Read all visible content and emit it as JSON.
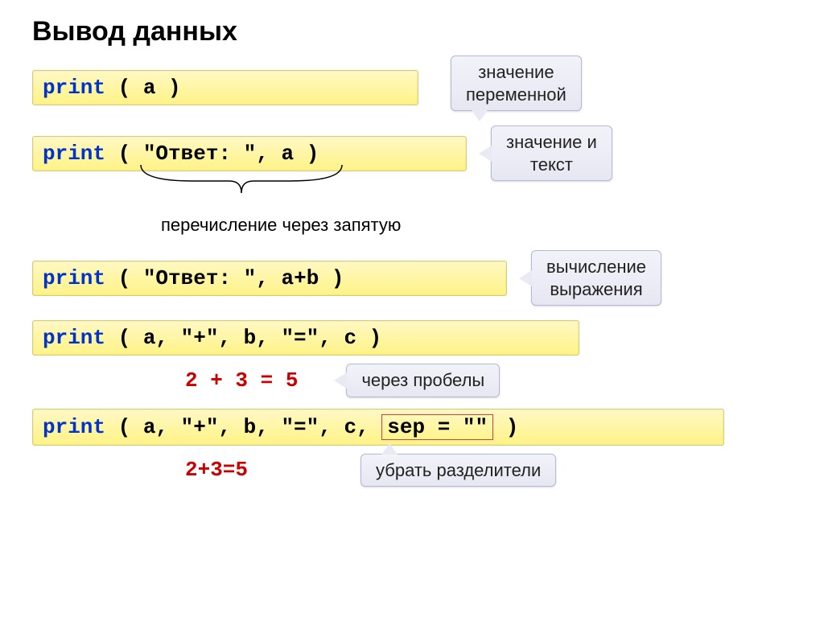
{
  "title": "Вывод данных",
  "ex1": {
    "print": "print",
    "open": " ( ",
    "var": "a",
    "close": " )",
    "callout_l1": "значение",
    "callout_l2": "переменной"
  },
  "ex2": {
    "print": "print",
    "open": " ( ",
    "str": "\"Ответ: \"",
    "comma": ", ",
    "var": "a",
    "close": " )",
    "callout_l1": "значение и",
    "callout_l2": "текст",
    "note": "перечисление через запятую"
  },
  "ex3": {
    "print": "print",
    "open": " ( ",
    "str": "\"Ответ: \"",
    "comma": ", ",
    "expr": "a+b",
    "close": " )",
    "callout_l1": "вычисление",
    "callout_l2": "выражения"
  },
  "ex4": {
    "print": "print",
    "code": " ( a, \"+\", b, \"=\", c )",
    "result": "2 + 3 = 5",
    "callout": "через пробелы"
  },
  "ex5": {
    "print": "print",
    "code_before": " ( a, \"+\", b, \"=\", c, ",
    "sep": "sep = \"\"",
    "code_after": " )",
    "result": "2+3=5",
    "callout": "убрать разделители"
  }
}
